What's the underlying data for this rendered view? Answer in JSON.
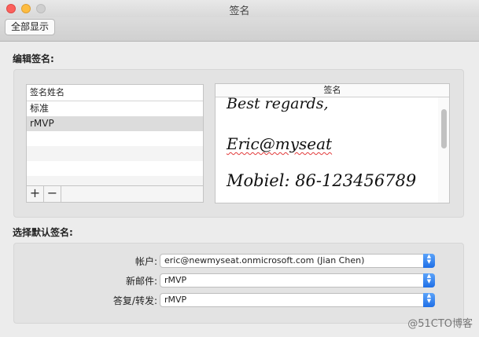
{
  "window": {
    "title": "签名"
  },
  "toolbar": {
    "show_all_label": "全部显示"
  },
  "edit_section": {
    "title": "编辑签名:",
    "list_header": "签名姓名",
    "signatures": [
      "标准",
      "rMVP"
    ],
    "selected": "rMVP",
    "add_label": "+",
    "remove_label": "−"
  },
  "editor": {
    "header": "签名",
    "lines": [
      "Best regards,",
      "Eric@myseat",
      "Mobiel: 86-123456789"
    ]
  },
  "default_section": {
    "title": "选择默认签名:",
    "account_label": "帐户:",
    "account_value": "eric@newmyseat.onmicrosoft.com (Jian Chen)",
    "new_mail_label": "新邮件:",
    "new_mail_value": "rMVP",
    "reply_label": "答复/转发:",
    "reply_value": "rMVP"
  },
  "watermark": "@51CTO博客",
  "icons": {
    "add": "plus-icon",
    "remove": "minus-icon",
    "select": "updown-arrows-icon"
  },
  "colors": {
    "accent": "#1f6fe6",
    "close": "#fc605c",
    "minimize": "#fdbc40"
  }
}
